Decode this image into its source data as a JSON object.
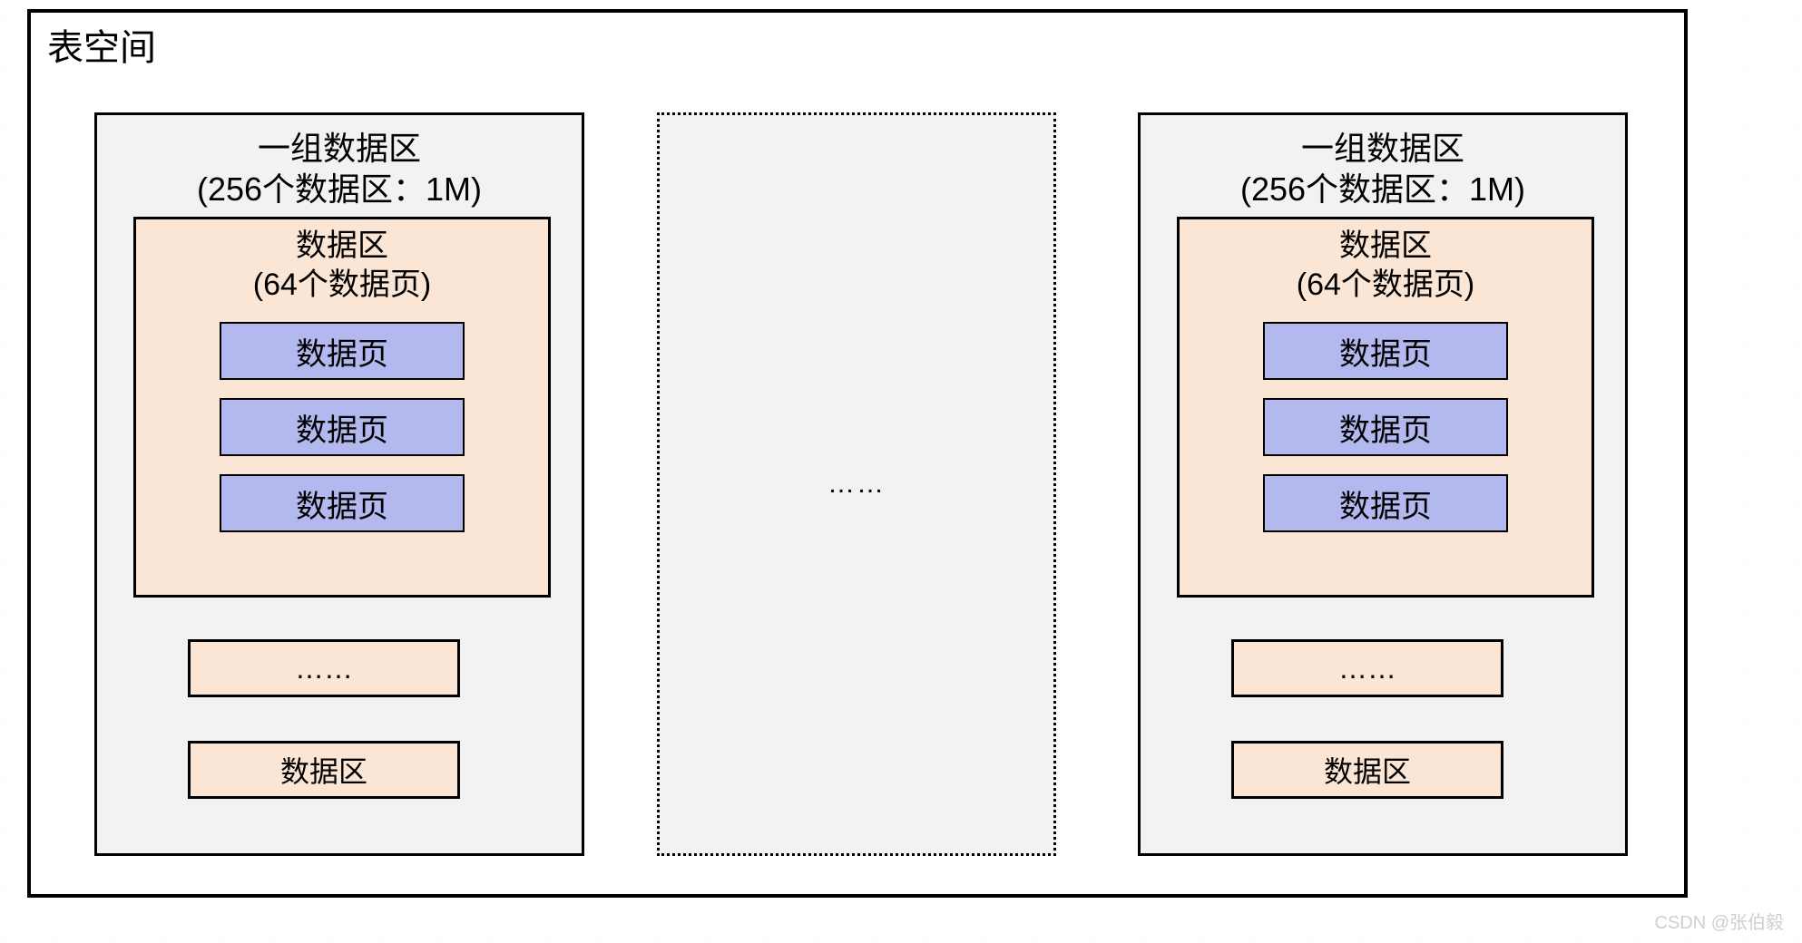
{
  "tablespace": {
    "title": "表空间"
  },
  "group": {
    "title_line1": "一组数据区",
    "title_line2": "(256个数据区：1M)"
  },
  "data_area": {
    "title_line1": "数据区",
    "title_line2": "(64个数据页)",
    "page_label": "数据页"
  },
  "more_label": "……",
  "last_area_label": "数据区",
  "middle_ellipsis": "……",
  "watermark": "CSDN @张伯毅"
}
